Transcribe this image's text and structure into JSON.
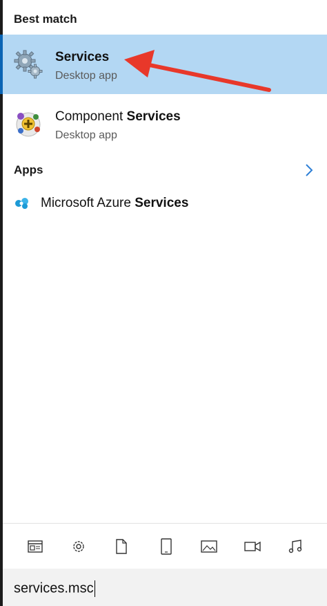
{
  "sections": {
    "best_match": "Best match",
    "apps": "Apps"
  },
  "best_match": [
    {
      "title_prefix": "",
      "title_bold": "Services",
      "subtitle": "Desktop app",
      "icon": "services-gear-icon",
      "selected": true
    },
    {
      "title_prefix": "Component ",
      "title_bold": "Services",
      "subtitle": "Desktop app",
      "icon": "component-services-icon",
      "selected": false
    }
  ],
  "apps": [
    {
      "title_prefix": "Microsoft Azure ",
      "title_bold": "Services",
      "icon": "azure-icon"
    }
  ],
  "filters": [
    "apps-filter-icon",
    "settings-filter-icon",
    "documents-filter-icon",
    "tablet-filter-icon",
    "photos-filter-icon",
    "videos-filter-icon",
    "music-filter-icon"
  ],
  "search": {
    "query": "services.msc"
  },
  "colors": {
    "selected_bg": "#b3d7f3",
    "accent": "#0a64b4",
    "arrow": "#e8382a",
    "chevron": "#2e7fd6"
  }
}
